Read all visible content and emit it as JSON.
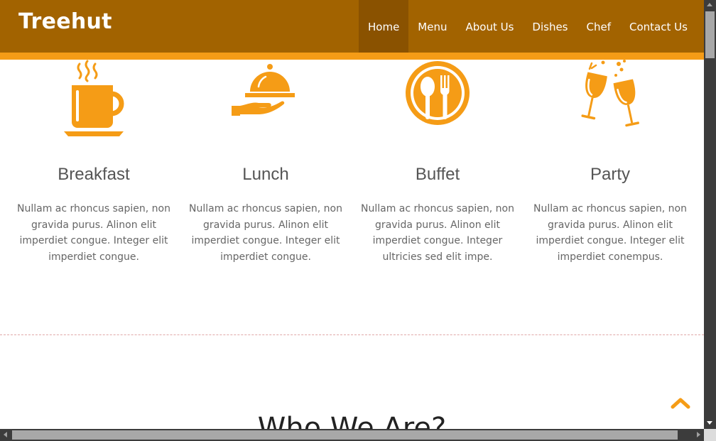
{
  "brand": {
    "name": "Treehut"
  },
  "nav": {
    "items": [
      {
        "label": "Home",
        "active": true
      },
      {
        "label": "Menu",
        "active": false
      },
      {
        "label": "About Us",
        "active": false
      },
      {
        "label": "Dishes",
        "active": false
      },
      {
        "label": "Chef",
        "active": false
      },
      {
        "label": "Contact Us",
        "active": false
      }
    ]
  },
  "services": [
    {
      "icon": "coffee-cup-icon",
      "title": "Breakfast",
      "text": "Nullam ac rhoncus sapien, non gravida purus. Alinon elit imperdiet congue. Integer elit imperdiet congue."
    },
    {
      "icon": "serving-cloche-icon",
      "title": "Lunch",
      "text": "Nullam ac rhoncus sapien, non gravida purus. Alinon elit imperdiet congue. Integer elit imperdiet congue."
    },
    {
      "icon": "plate-spoon-fork-icon",
      "title": "Buffet",
      "text": "Nullam ac rhoncus sapien, non gravida purus. Alinon elit imperdiet congue. Integer ultricies sed elit impe."
    },
    {
      "icon": "wine-glasses-toast-icon",
      "title": "Party",
      "text": "Nullam ac rhoncus sapien, non gravida purus. Alinon elit imperdiet congue. Integer elit imperdiet conempus."
    }
  ],
  "section": {
    "heading": "Who We Are?"
  },
  "back_to_top": {
    "icon": "chevron-up-icon"
  },
  "colors": {
    "header": "#a26300",
    "accent": "#f59c16",
    "active_nav": "#8a5200"
  }
}
